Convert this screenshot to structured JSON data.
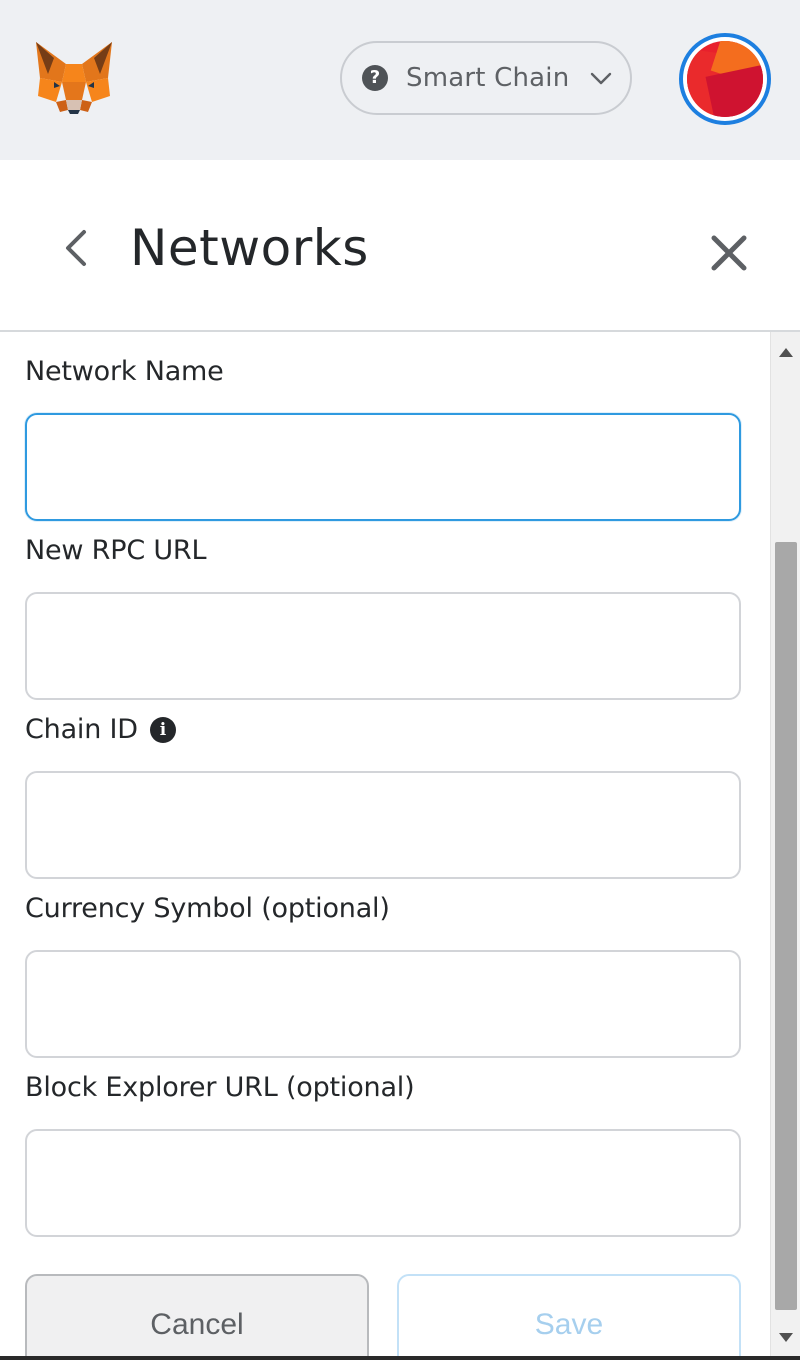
{
  "header": {
    "logo_icon": "metamask-fox-icon",
    "network": {
      "label": "Smart Chain",
      "status_icon": "question-circle-icon",
      "status_glyph": "?",
      "dropdown_icon": "chevron-down-icon"
    },
    "account_avatar": {
      "icon": "jazzicon-avatar",
      "ring_color": "#1d7fe0"
    }
  },
  "page": {
    "title": "Networks",
    "back_icon": "chevron-left-icon",
    "close_icon": "close-icon"
  },
  "form": {
    "fields": [
      {
        "label": "Network Name",
        "value": "",
        "focused": true
      },
      {
        "label": "New RPC URL",
        "value": ""
      },
      {
        "label": "Chain ID",
        "value": "",
        "info_icon": "info-circle-icon",
        "info_glyph": "i"
      },
      {
        "label": "Currency Symbol (optional)",
        "value": ""
      },
      {
        "label": "Block Explorer URL (optional)",
        "value": ""
      }
    ],
    "buttons": {
      "cancel_label": "Cancel",
      "save_label": "Save"
    }
  },
  "colors": {
    "header_bg": "#eef0f3",
    "focus_border": "#2f9ae0",
    "save_text_disabled": "#a6cfee",
    "fox_orange": "#f6851b"
  }
}
